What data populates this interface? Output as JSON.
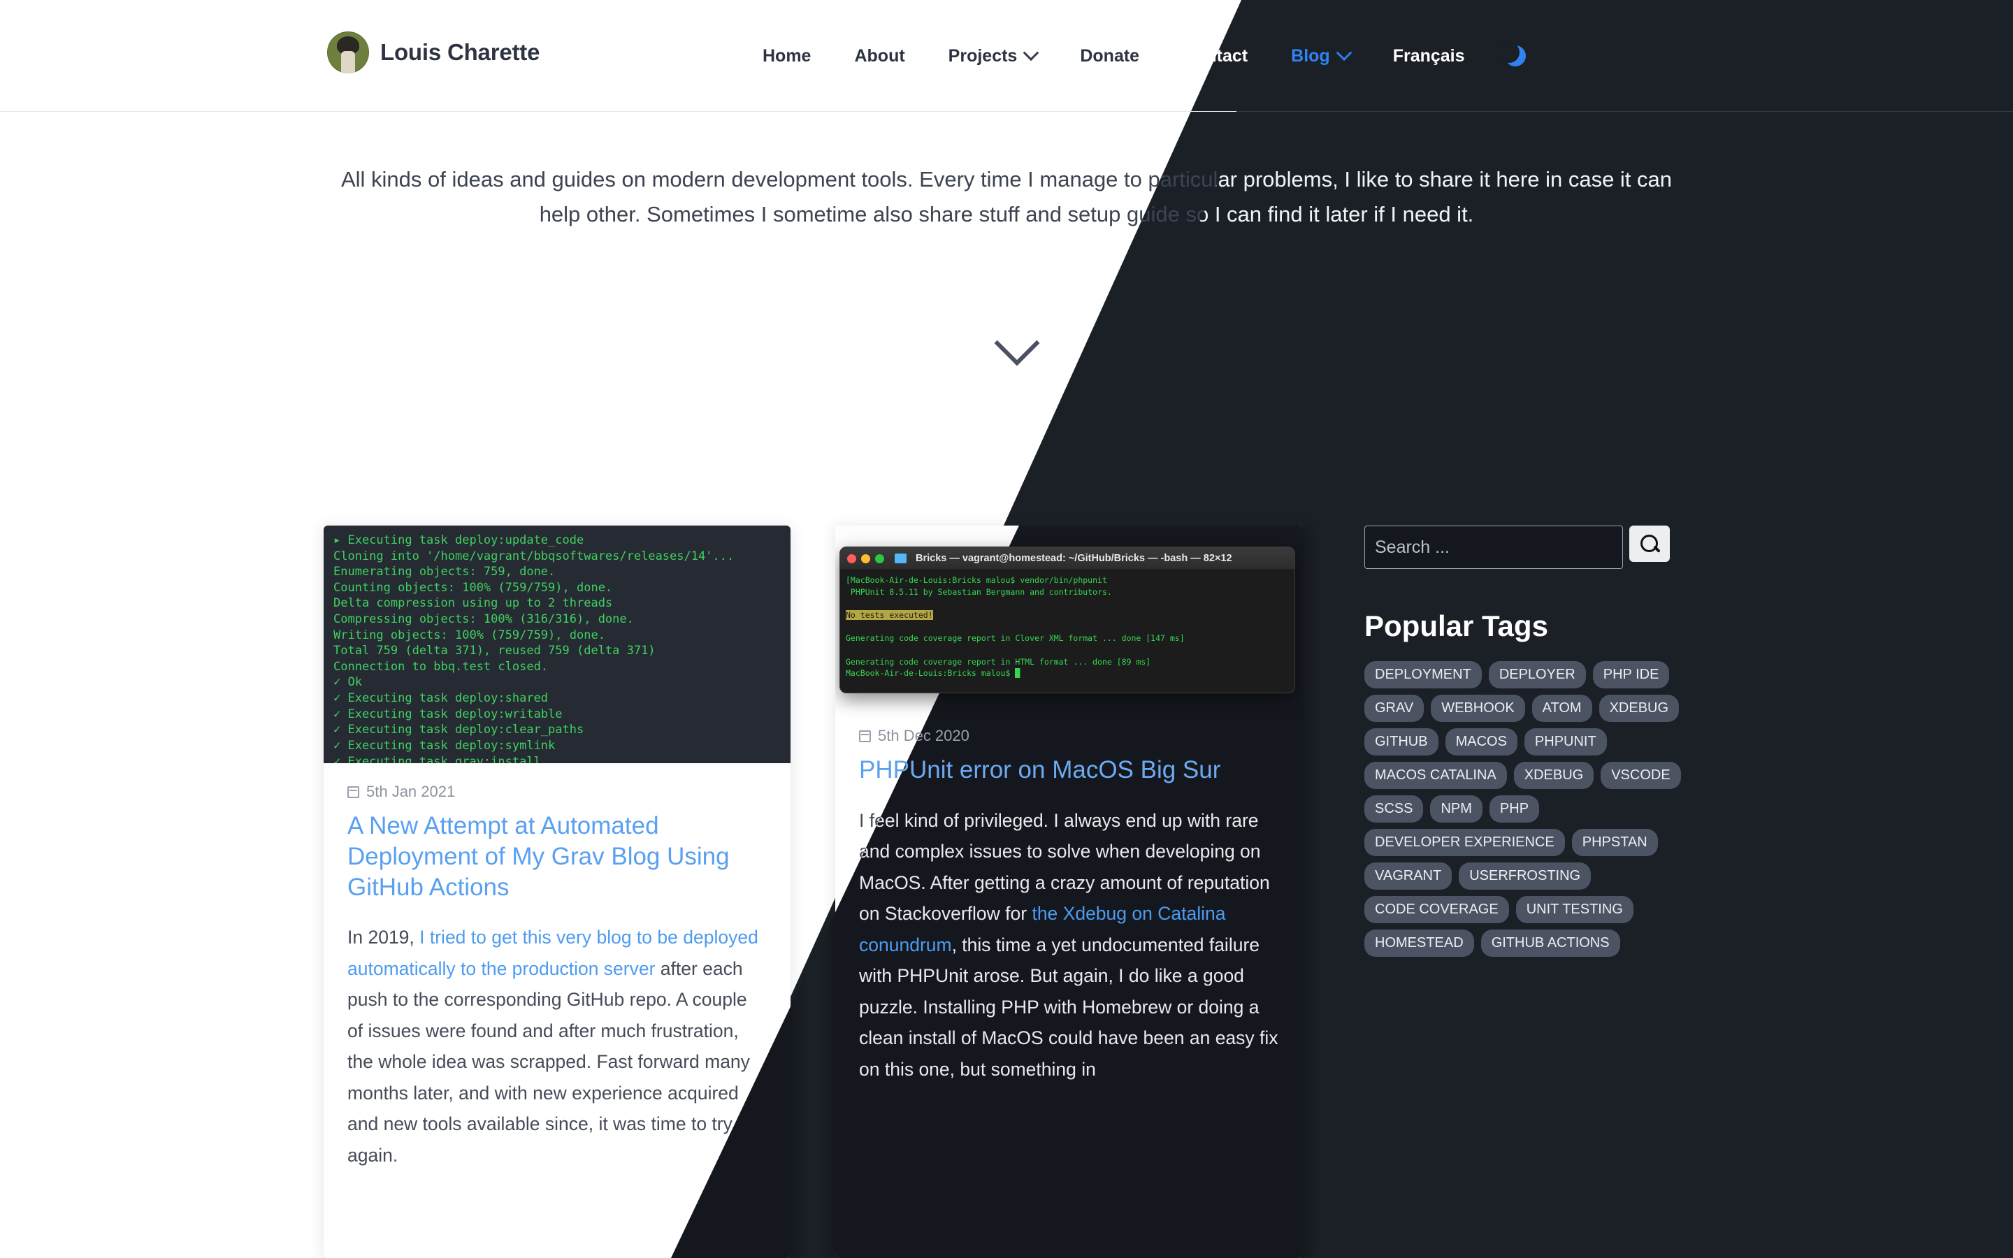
{
  "header": {
    "brand_name": "Louis Charette",
    "avatar_icon": "avatar-image",
    "nav": [
      {
        "label": "Home",
        "has_chevron": false,
        "active": false
      },
      {
        "label": "About",
        "has_chevron": false,
        "active": false
      },
      {
        "label": "Projects",
        "has_chevron": true,
        "active": false
      },
      {
        "label": "Donate",
        "has_chevron": false,
        "active": false
      },
      {
        "label": "Contact",
        "has_chevron": false,
        "active": false
      },
      {
        "label": "Blog",
        "has_chevron": true,
        "active": true
      },
      {
        "label": "Français",
        "has_chevron": false,
        "active": false
      }
    ],
    "dark_mode_icon": "moon-icon",
    "accent_color": "#2f84f2",
    "dark_bg_color": "#1b1f26"
  },
  "intro": {
    "text": "All kinds of ideas and guides on modern development tools. Every time I manage to particular problems, I like to share it here in case it can help other. Sometimes I sometime also share stuff and setup guide so I can find it later if I need it.",
    "scroll_icon": "chevron-down-icon"
  },
  "posts": [
    {
      "date": "5th Jan 2021",
      "date_icon": "calendar-icon",
      "title": "A New Attempt at Automated Deployment of My Grav Blog Using GitHub Actions",
      "excerpt_before_link": "In 2019, ",
      "excerpt_link": "I tried to get this very blog to be deployed automatically to the production server",
      "excerpt_after_link": " after each push to the corresponding GitHub repo. A couple of issues were found and after much frustration, the whole idea was scrapped. Fast forward many months later, and with new experience acquired and new tools available since, it was time to try again.",
      "media_type": "terminal-plain",
      "terminal_lines": [
        "▸ Executing task deploy:update_code",
        "Cloning into '/home/vagrant/bbqsoftwares/releases/14'...",
        "Enumerating objects: 759, done.",
        "Counting objects: 100% (759/759), done.",
        "Delta compression using up to 2 threads",
        "Compressing objects: 100% (316/316), done.",
        "Writing objects: 100% (759/759), done.",
        "Total 759 (delta 371), reused 759 (delta 371)",
        "Connection to bbq.test closed.",
        "✓ Ok",
        "✓ Executing task deploy:shared",
        "✓ Executing task deploy:writable",
        "✓ Executing task deploy:clear_paths",
        "✓ Executing task deploy:symlink",
        "✓ Executing task grav:install"
      ]
    },
    {
      "date": "5th Dec 2020",
      "date_icon": "calendar-icon",
      "title": "PHPUnit error on MacOS Big Sur",
      "excerpt_before_link": "I feel kind of privileged. I always end up with rare and complex issues to solve when developing on MacOS. After getting a crazy amount of reputation on Stackoverflow for ",
      "excerpt_link": "the Xdebug on Catalina conundrum",
      "excerpt_after_link": ", this time a yet undocumented failure with PHPUnit arose. But again, I do like a good puzzle. Installing PHP with Homebrew or doing a clean install of MacOS could have been an easy fix on this one, but something in",
      "media_type": "terminal-mac",
      "mac_window": {
        "title": "Bricks — vagrant@homestead: ~/GitHub/Bricks — -bash — 82×12",
        "folder_icon": "folder-icon",
        "traffic_lights": [
          "close-red",
          "minimize-yellow",
          "maximize-green"
        ],
        "lines": [
          "[MacBook-Air-de-Louis:Bricks malou$ vendor/bin/phpunit",
          " PHPUnit 8.5.11 by Sebastian Bergmann and contributors.",
          "",
          "No tests executed!",
          "",
          "Generating code coverage report in Clover XML format ... done [147 ms]",
          "",
          "Generating code coverage report in HTML format ... done [89 ms]",
          "MacBook-Air-de-Louis:Bricks malou$ "
        ],
        "highlight_line": "No tests executed!"
      }
    }
  ],
  "sidebar": {
    "search": {
      "placeholder": "Search ...",
      "value": "",
      "button_icon": "search-icon"
    },
    "tags_title": "Popular Tags",
    "tags": [
      "DEPLOYMENT",
      "DEPLOYER",
      "PHP IDE",
      "GRAV",
      "WEBHOOK",
      "ATOM",
      "XDEBUG",
      "GITHUB",
      "MACOS",
      "PHPUNIT",
      "MACOS CATALINA",
      "XDEBUG",
      "VSCODE",
      "SCSS",
      "NPM",
      "PHP",
      "DEVELOPER EXPERIENCE",
      "PHPSTAN",
      "VAGRANT",
      "USERFROSTING",
      "CODE COVERAGE",
      "UNIT TESTING",
      "HOMESTEAD",
      "GITHUB ACTIONS"
    ]
  }
}
